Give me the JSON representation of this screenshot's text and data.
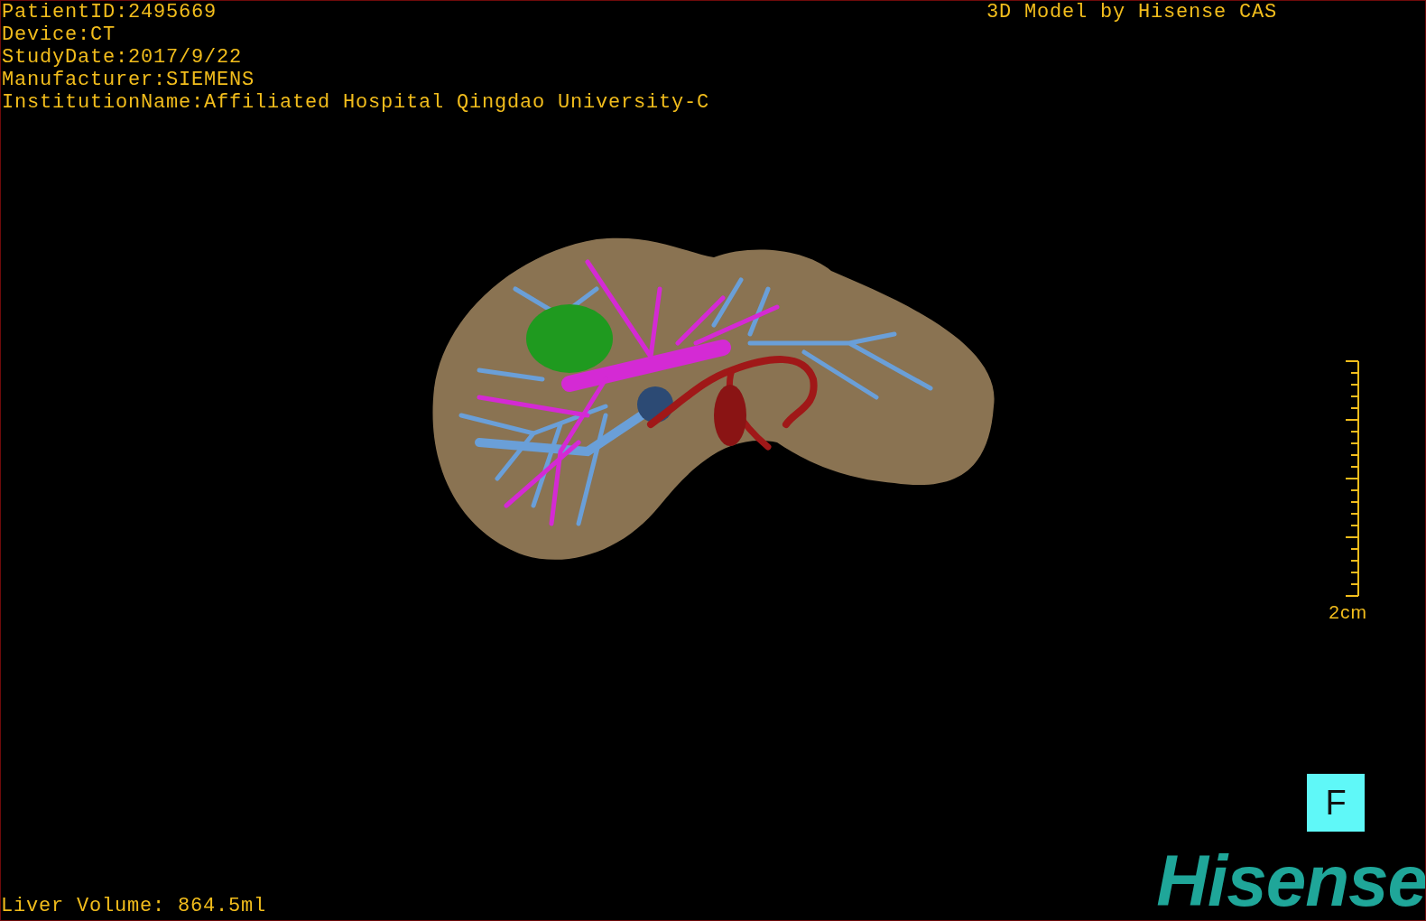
{
  "info_lines": [
    "PatientID:2495669",
    "Device:CT",
    "StudyDate:2017/9/22",
    "Manufacturer:SIEMENS",
    "InstitutionName:Affiliated Hospital Qingdao University-C"
  ],
  "title": "3D Model by Hisense CAS",
  "scale_bar": {
    "label": "2cm"
  },
  "view_button": {
    "label": "F"
  },
  "liver_volume": "Liver Volume: 864.5ml",
  "logo": "Hisense"
}
